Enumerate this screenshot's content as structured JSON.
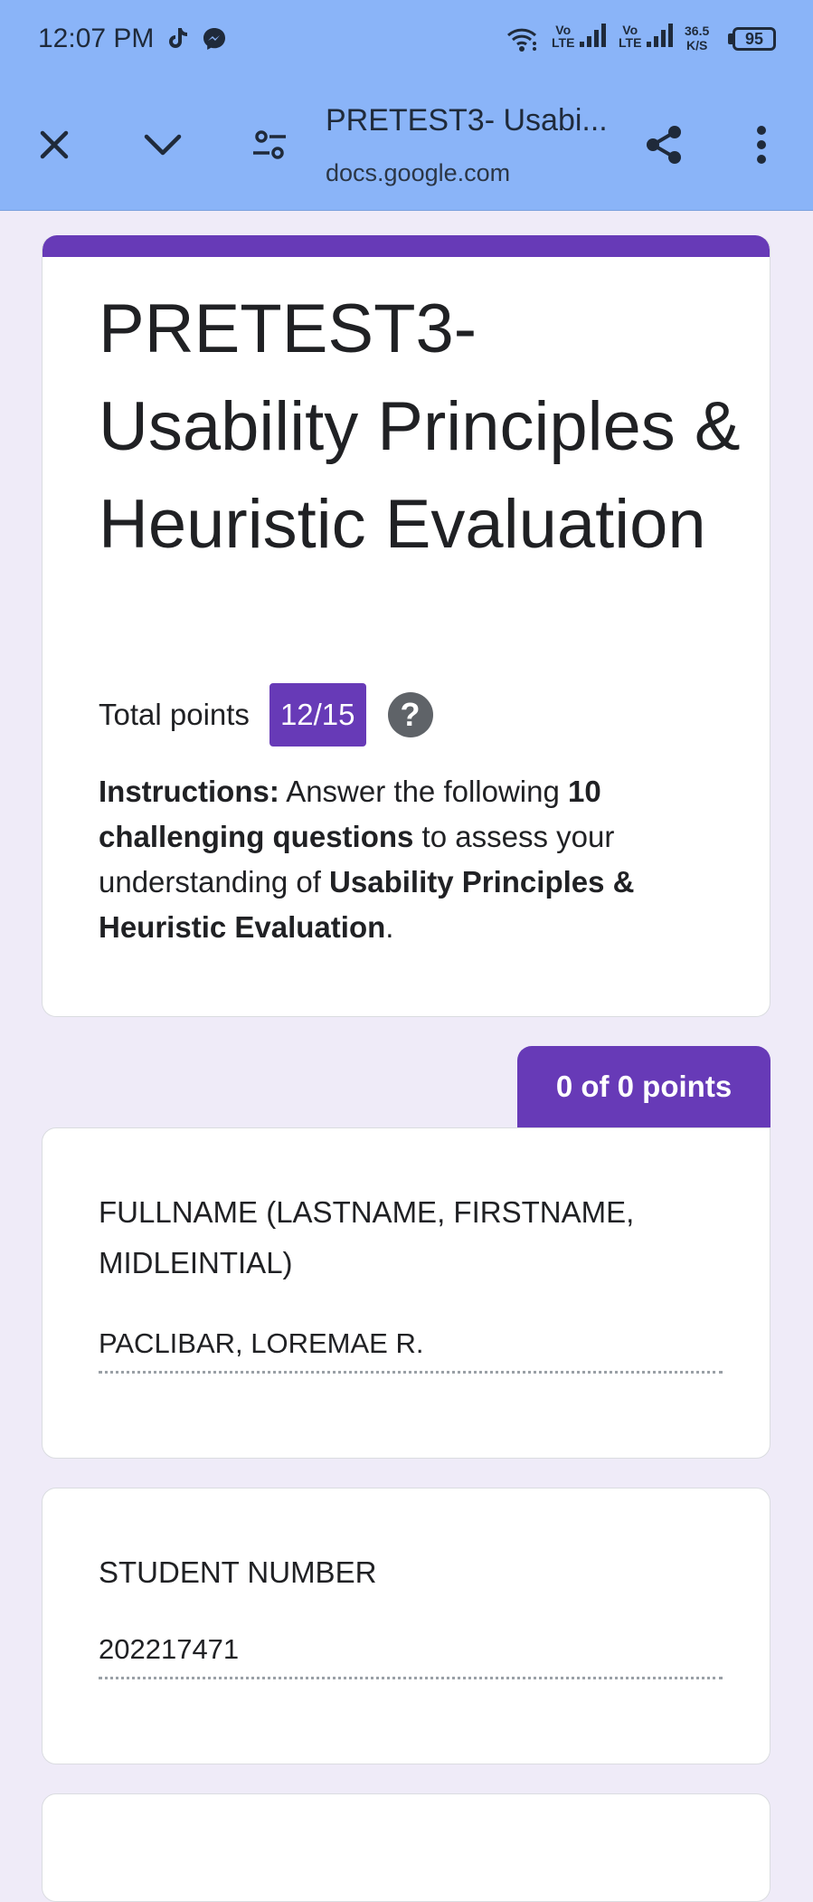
{
  "status_bar": {
    "time": "12:07 PM",
    "sim1_label_top": "Vo",
    "sim1_label_bottom": "LTE",
    "sim2_label_top": "Vo",
    "sim2_label_bottom": "LTE",
    "speed_value": "36.5",
    "speed_unit": "K/S",
    "battery": "95"
  },
  "browser": {
    "title": "PRETEST3- Usabi...",
    "url": "docs.google.com"
  },
  "form": {
    "title": "PRETEST3- Usability Principles & Heuristic Evaluation",
    "total_points_label": "Total points",
    "score": "12/15",
    "help_symbol": "?",
    "instructions": {
      "lead": "Instructions:",
      "t1": " Answer the following ",
      "b1": "10 challenging questions",
      "t2": " to assess your understanding of ",
      "b2": "Usability Principles & Heuristic Evaluation",
      "t3": "."
    }
  },
  "section": {
    "points": "0 of 0 points"
  },
  "questions": [
    {
      "title": "FULLNAME (LASTNAME, FIRSTNAME, MIDLEINTIAL)",
      "answer": "PACLIBAR, LOREMAE R."
    },
    {
      "title": "STUDENT NUMBER",
      "answer": "202217471"
    }
  ],
  "colors": {
    "accent": "#673ab7",
    "header": "#8ab4f8",
    "background": "#efebf8"
  },
  "icons": [
    "tiktok-icon",
    "messenger-icon",
    "wifi-icon",
    "signal-icon",
    "close-icon",
    "chevron-down-icon",
    "page-settings-icon",
    "share-icon",
    "more-vert-icon",
    "help-icon"
  ]
}
